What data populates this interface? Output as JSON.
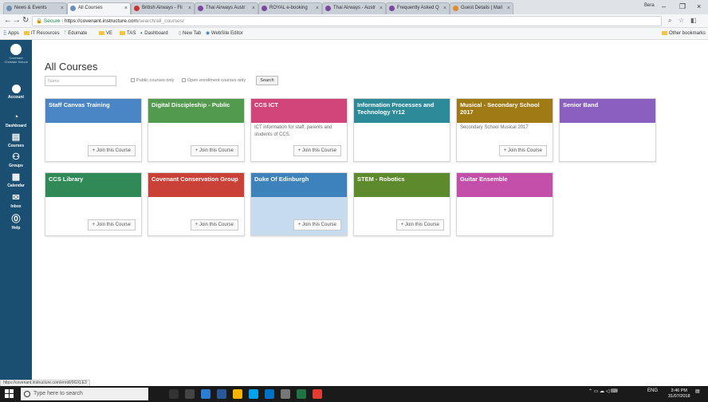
{
  "browser": {
    "tabs": [
      {
        "label": "News & Events"
      },
      {
        "label": "All Courses"
      },
      {
        "label": "British Airways - Fli"
      },
      {
        "label": "Thai Airways Austr"
      },
      {
        "label": "ROYAL e-booking"
      },
      {
        "label": "Thai Airways - Austr"
      },
      {
        "label": "Frequently Asked Q"
      },
      {
        "label": "Guest Details | Mail"
      }
    ],
    "user_badge": "Bera",
    "secure_label": "Secure",
    "url_host": "https://covenant.instructure.com",
    "url_path": "/search/all_courses/",
    "bookmarks": {
      "apps": "Apps",
      "items": [
        "IT Resources",
        "Edumate",
        "VE",
        "TAS",
        "Dashboard",
        "New Tab",
        "WebSite Editor"
      ],
      "other": "Other bookmarks"
    }
  },
  "nav": {
    "logo_text": "Covenant Christian School",
    "items": [
      {
        "label": "Account",
        "icon": "avatar-icon"
      },
      {
        "label": "Dashboard",
        "glyph": "◔"
      },
      {
        "label": "Courses",
        "glyph": "▤"
      },
      {
        "label": "Groups",
        "glyph": "⚇"
      },
      {
        "label": "Calendar",
        "glyph": "▦"
      },
      {
        "label": "Inbox",
        "glyph": "✉"
      },
      {
        "label": "Help",
        "glyph": "⓪"
      }
    ]
  },
  "main": {
    "title": "All Courses",
    "search_placeholder": "Name",
    "public_only_label": "Public courses only",
    "open_enrollment_label": "Open enrollment courses only",
    "search_button": "Search"
  },
  "courses": [
    {
      "name": "Staff Canvas Training",
      "color": "#4a86c5",
      "description": "",
      "join": "Join this Course"
    },
    {
      "name": "Digital Discipleship - Public",
      "color": "#529a4d",
      "description": "",
      "join": "Join this Course"
    },
    {
      "name": "CCS ICT",
      "color": "#d2457a",
      "description": "ICT information for staff, parents and students of CCS.",
      "join": "Join this Course"
    },
    {
      "name": "Information Processes and Technology Yr12",
      "color": "#2c8a99",
      "description": "",
      "join": ""
    },
    {
      "name": "Musical - Secondary School 2017",
      "color": "#a07a14",
      "description": "Secondary School Musical 2017",
      "join": "Join this Course"
    },
    {
      "name": "Senior Band",
      "color": "#8a5fbf",
      "description": "",
      "join": ""
    },
    {
      "name": "CCS Library",
      "color": "#2f8a57",
      "description": "",
      "join": "Join this Course"
    },
    {
      "name": "Covenant Conservation Group",
      "color": "#c94137",
      "description": "",
      "join": "Join this Course"
    },
    {
      "name": "Duke Of Edinburgh",
      "color": "#3d82ba",
      "description": "",
      "join": "Join this Course"
    },
    {
      "name": "STEM - Robotics",
      "color": "#5e8a2e",
      "description": "",
      "join": "Join this Course"
    },
    {
      "name": "Guitar Ensemble",
      "color": "#c44fab",
      "description": "",
      "join": ""
    }
  ],
  "status_url": "https://covenant.instructure.com/enroll/9GXLE3",
  "taskbar": {
    "search_placeholder": "Type here to search",
    "lang": "ENG",
    "time": "3:46 PM",
    "date": "31/07/2018"
  }
}
